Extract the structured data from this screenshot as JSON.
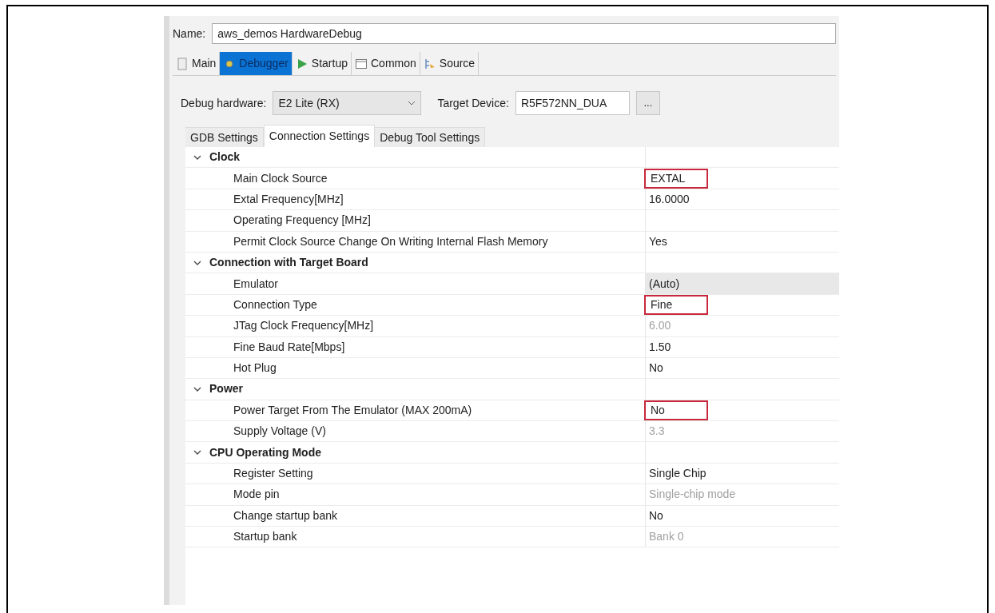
{
  "name_field": {
    "label": "Name:",
    "value": "aws_demos HardwareDebug"
  },
  "tabs": [
    {
      "label": "Main",
      "kind": "page",
      "selected": false
    },
    {
      "label": "Debugger",
      "kind": "bug",
      "selected": true
    },
    {
      "label": "Startup",
      "kind": "play",
      "selected": false
    },
    {
      "label": "Common",
      "kind": "window",
      "selected": false
    },
    {
      "label": "Source",
      "kind": "source",
      "selected": false
    }
  ],
  "debug_hardware": {
    "label": "Debug hardware:",
    "value": "E2 Lite (RX)"
  },
  "target_device": {
    "label": "Target Device:",
    "value": "R5F572NN_DUA",
    "button": "..."
  },
  "subtabs": [
    {
      "label": "GDB Settings",
      "selected": false
    },
    {
      "label": "Connection Settings",
      "selected": true
    },
    {
      "label": "Debug Tool Settings",
      "selected": false
    }
  ],
  "groups": [
    {
      "label": "Clock",
      "expanded": true,
      "properties": [
        {
          "label": "Main Clock Source",
          "value": "EXTAL",
          "disabled": false,
          "highlighted": true,
          "selected": false
        },
        {
          "label": "Extal Frequency[MHz]",
          "value": "16.0000",
          "disabled": false,
          "highlighted": false,
          "selected": false
        },
        {
          "label": "Operating Frequency [MHz]",
          "selected": false
        },
        {
          "label": "Permit Clock Source Change On Writing Internal Flash Memory",
          "value": "Yes",
          "disabled": false,
          "highlighted": false,
          "selected": false
        }
      ]
    },
    {
      "label": "Connection with Target Board",
      "expanded": true,
      "properties": [
        {
          "label": "Emulator",
          "value": "(Auto)",
          "disabled": false,
          "highlighted": false,
          "selected": true
        },
        {
          "label": "Connection Type",
          "value": "Fine",
          "disabled": false,
          "highlighted": true,
          "selected": false
        },
        {
          "label": "JTag Clock Frequency[MHz]",
          "value": "6.00",
          "disabled": true,
          "highlighted": false,
          "selected": false
        },
        {
          "label": "Fine Baud Rate[Mbps]",
          "value": "1.50",
          "disabled": false,
          "highlighted": false,
          "selected": false
        },
        {
          "label": "Hot Plug",
          "value": "No",
          "disabled": false,
          "highlighted": false,
          "selected": false
        }
      ]
    },
    {
      "label": "Power",
      "expanded": true,
      "properties": [
        {
          "label": "Power Target From The Emulator (MAX 200mA)",
          "value": "No",
          "disabled": false,
          "highlighted": true,
          "selected": false
        },
        {
          "label": "Supply Voltage (V)",
          "value": "3.3",
          "disabled": true,
          "highlighted": false,
          "selected": false
        }
      ]
    },
    {
      "label": "CPU Operating Mode",
      "expanded": true,
      "properties": [
        {
          "label": "Register Setting",
          "value": "Single Chip",
          "disabled": false,
          "highlighted": false,
          "selected": false
        },
        {
          "label": "Mode pin",
          "value": "Single-chip mode",
          "disabled": true,
          "highlighted": false,
          "selected": false
        },
        {
          "label": "Change startup bank",
          "value": "No",
          "disabled": false,
          "highlighted": false,
          "selected": false
        },
        {
          "label": "Startup bank",
          "value": "Bank 0",
          "disabled": true,
          "highlighted": false,
          "selected": false
        }
      ]
    }
  ]
}
